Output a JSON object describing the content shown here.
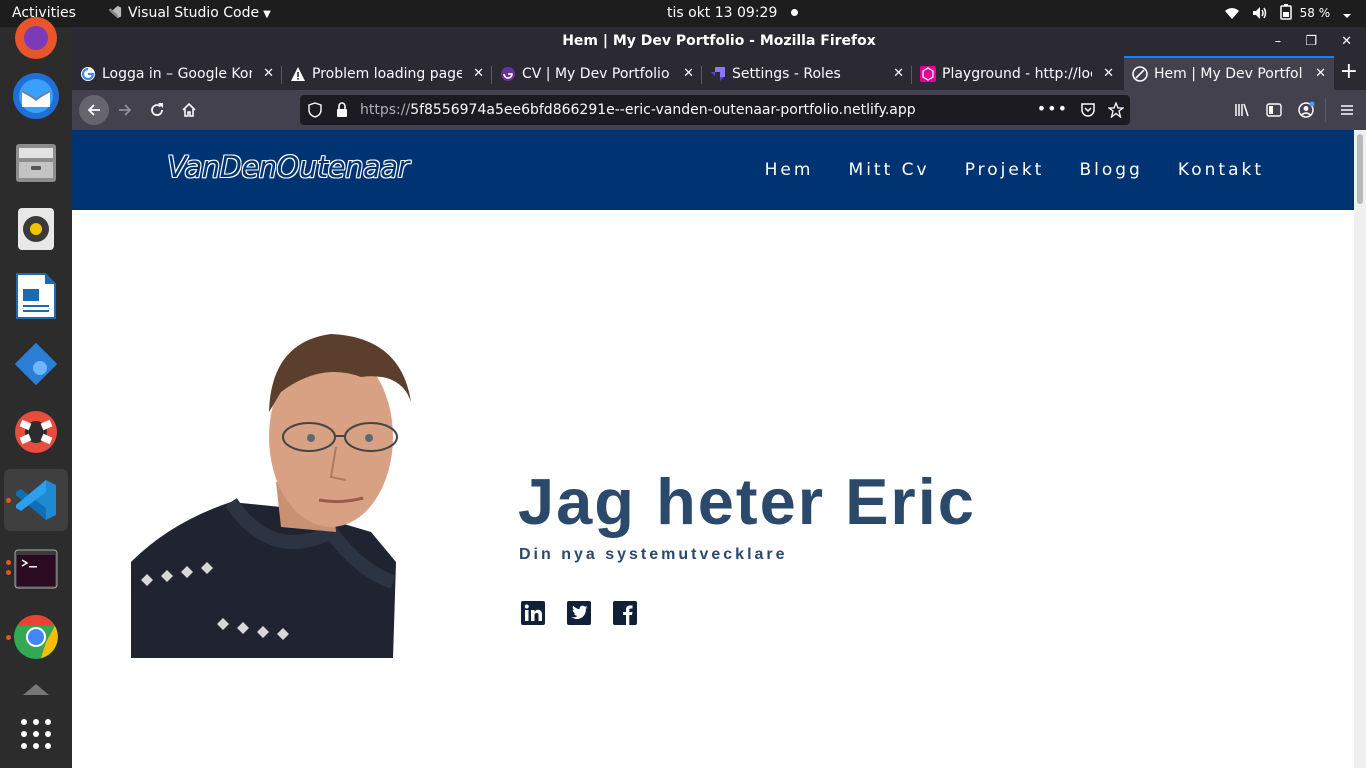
{
  "topbar": {
    "activities": "Activities",
    "app_name": "Visual Studio Code",
    "clock": "tis okt 13  09:29",
    "battery": "58 %"
  },
  "dock": {
    "items": [
      "firefox",
      "thunderbird",
      "files",
      "rhythmbox",
      "libreoffice-writer",
      "software-updater",
      "help",
      "visual-studio-code",
      "terminal",
      "chrome",
      "trash",
      "show-applications"
    ]
  },
  "window": {
    "title": "Hem | My Dev Portfolio - Mozilla Firefox"
  },
  "tabs": [
    {
      "label": "Logga in – Google Kon",
      "icon": "google-icon"
    },
    {
      "label": "Problem loading page",
      "icon": "warning-icon"
    },
    {
      "label": "CV | My Dev Portfolio",
      "icon": "gatsby-icon"
    },
    {
      "label": "Settings - Roles",
      "icon": "strapi-icon"
    },
    {
      "label": "Playground - http://loc",
      "icon": "graphql-icon"
    },
    {
      "label": "Hem | My Dev Portfolio",
      "icon": "netlify-icon",
      "active": true
    }
  ],
  "urlbar": {
    "url_prefix": "https://",
    "url_main": "5f8556974a5ee6bfd866291e--eric-vanden-outenaar-portfolio.netlify.app"
  },
  "site": {
    "logo": "VanDenOutenaar",
    "menu": [
      "Hem",
      "Mitt Cv",
      "Projekt",
      "Blogg",
      "Kontakt"
    ],
    "hero_title": "Jag heter Eric",
    "hero_subtitle": "Din nya systemutvecklare",
    "socials": [
      "linkedin-icon",
      "twitter-icon",
      "facebook-icon"
    ]
  },
  "colors": {
    "nav_bg": "#003371",
    "heading": "#2b4a6b",
    "accent_tab": "#0a84ff"
  }
}
